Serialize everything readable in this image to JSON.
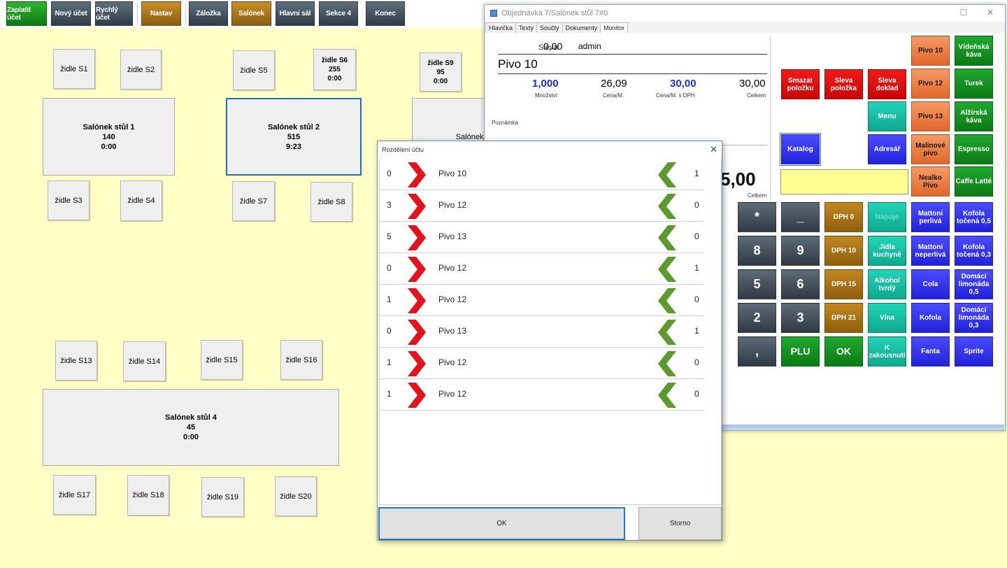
{
  "toolbar": {
    "pay": "Zaplatit účet",
    "new": "Nový účet",
    "quick": "Rychlý účet",
    "settings": "Nastav",
    "bookmark": "Záložka",
    "lounge": "Salónek",
    "main_hall": "Hlavní sál",
    "section4": "Sekce 4",
    "end": "Konec"
  },
  "floor": {
    "chairs": {
      "s1": "židle S1",
      "s2": "židle S2",
      "s3": "židle S3",
      "s4": "židle S4",
      "s5": "židle S5",
      "s7": "židle S7",
      "s8": "židle S8",
      "s13": "židle S13",
      "s14": "židle S14",
      "s15": "židle S15",
      "s16": "židle S16",
      "s17": "židle S17",
      "s18": "židle S18",
      "s19": "židle S19",
      "s20": "židle S20"
    },
    "s6": {
      "name": "židle S6",
      "value": "255",
      "time": "0:00"
    },
    "s9": {
      "name": "židle S9",
      "value": "95",
      "time": "0:00"
    },
    "table1": {
      "name": "Salónek stůl 1",
      "value": "140",
      "time": "0:00"
    },
    "table2": {
      "name": "Salónek stůl 2",
      "value": "515",
      "time": "9:23"
    },
    "table3_partial": "Salónek s",
    "table4": {
      "name": "Salónek stůl 4",
      "value": "45",
      "time": "0:00"
    }
  },
  "order_window": {
    "title": "Objednávka 7/Salónek stůl 7#0",
    "tabs": [
      "Hlavička",
      "Texty",
      "Součty",
      "Dokumenty",
      "Monitor"
    ],
    "discount_label": "Sleva:",
    "discount_value": "0,00",
    "user": "admin",
    "item_name": "Pivo 10",
    "quantity": "1,000",
    "quantity_label": "Množství",
    "unit_price": "26,09",
    "unit_price_label": "Cena/M.",
    "unit_price_vat": "30,00",
    "unit_price_vat_label": "Cena/M. s DPH",
    "total": "30,00",
    "total_label": "Celkem",
    "note_label": "Poznámka",
    "grand_total": "5,00",
    "grand_total_label": "Celkem",
    "buttons": {
      "delete_item": "Smazat položku",
      "discount_item": "Sleva položka",
      "discount_doc": "Sleva doklad",
      "menu": "Menu",
      "catalog": "Katalog",
      "address_book": "Adresář",
      "pivo10": "Pivo 10",
      "pivo12": "Pivo 12",
      "pivo13": "Pivo 13",
      "raspberry_beer": "Malinové pivo",
      "nealko": "Nealko Pivo",
      "viennese": "Vídeňská káva",
      "turkish": "Turek",
      "algerian": "Alžírská káva",
      "espresso": "Espresso",
      "latte": "Caffe Latté",
      "star": "*",
      "minus": "_",
      "n8": "8",
      "n9": "9",
      "n5": "5",
      "n6": "6",
      "n2": "2",
      "n3": "3",
      "comma": ",",
      "plu": "PLU",
      "ok": "OK",
      "vat0": "DPH 0",
      "vat10": "DPH 10",
      "vat15": "DPH 15",
      "vat21": "DPH 21",
      "drinks": "Nápoje",
      "kitchen": "Jídla kuchyně",
      "liquor": "Alkohol tvrdý",
      "wine": "Vína",
      "snacks": "K zakousnutí",
      "mattoni_spark": "Mattoni perlivá",
      "mattoni_still": "Mattoni neperlivá",
      "cola": "Cola",
      "kofola": "Kofola",
      "fanta": "Fanta",
      "kofola05": "Kofola točená 0,5",
      "kofola03": "Kofola točená 0,3",
      "lemonade05": "Domácí limonáda 0,5",
      "lemonade03": "Domácí limonáda 0,3",
      "sprite": "Sprite"
    }
  },
  "split_dialog": {
    "title": "Rozdělení účtu",
    "rows": [
      {
        "left": "0",
        "name": "Pivo 10",
        "right": "1"
      },
      {
        "left": "3",
        "name": "Pivo 12",
        "right": "0"
      },
      {
        "left": "5",
        "name": "Pivo 13",
        "right": "0"
      },
      {
        "left": "0",
        "name": "Pivo 12",
        "right": "1"
      },
      {
        "left": "1",
        "name": "Pivo 12",
        "right": "0"
      },
      {
        "left": "0",
        "name": "Pivo 13",
        "right": "1"
      },
      {
        "left": "1",
        "name": "Pivo 12",
        "right": "0"
      },
      {
        "left": "1",
        "name": "Pivo 12",
        "right": "0"
      }
    ],
    "ok": "OK",
    "cancel": "Storno"
  },
  "colors": {
    "background": "#ffffc6",
    "arrow_right": "#e3121b",
    "arrow_left": "#5c9a2d",
    "accent": "#2a76c8"
  }
}
